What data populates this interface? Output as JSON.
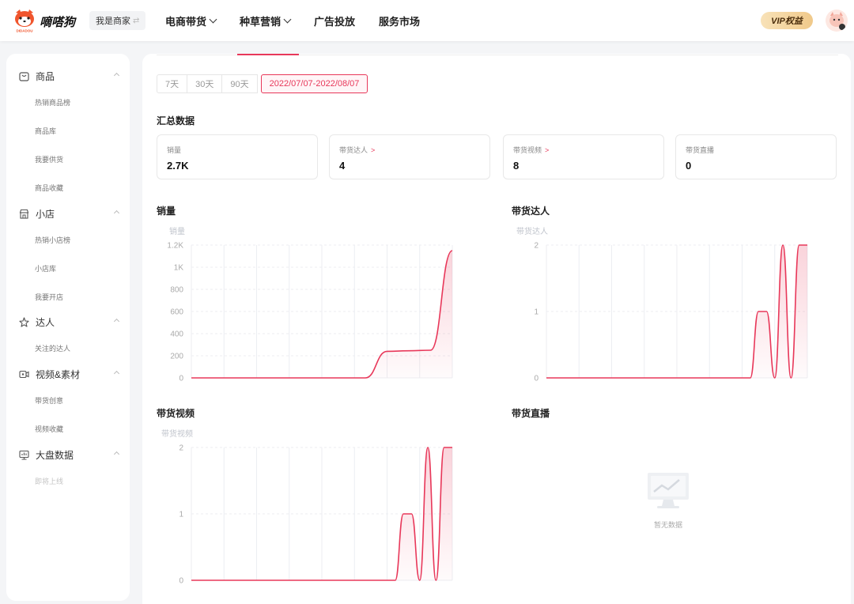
{
  "header": {
    "brand": "嘀嗒狗",
    "logo_text": "DIDADOU",
    "role_switch": "我是商家",
    "nav": [
      {
        "label": "电商带货",
        "has_dropdown": true
      },
      {
        "label": "种草营销",
        "has_dropdown": true
      },
      {
        "label": "广告投放",
        "has_dropdown": false
      },
      {
        "label": "服务市场",
        "has_dropdown": false
      }
    ],
    "vip_label": "VIP权益"
  },
  "sidebar": {
    "groups": [
      {
        "label": "商品",
        "icon": "product-icon",
        "items": [
          {
            "label": "热销商品榜"
          },
          {
            "label": "商品库"
          },
          {
            "label": "我要供货"
          },
          {
            "label": "商品收藏"
          }
        ]
      },
      {
        "label": "小店",
        "icon": "shop-icon",
        "items": [
          {
            "label": "热销小店榜"
          },
          {
            "label": "小店库"
          },
          {
            "label": "我要开店"
          }
        ]
      },
      {
        "label": "达人",
        "icon": "influencer-icon",
        "items": [
          {
            "label": "关注的达人"
          }
        ]
      },
      {
        "label": "视频&素材",
        "icon": "video-icon",
        "items": [
          {
            "label": "带货创意"
          },
          {
            "label": "视频收藏"
          }
        ]
      },
      {
        "label": "大盘数据",
        "icon": "dashboard-icon",
        "items": [
          {
            "label": "即将上线",
            "disabled": true
          }
        ]
      }
    ]
  },
  "main": {
    "ranges": [
      "7天",
      "30天",
      "90天"
    ],
    "active_range": "2022/07/07-2022/08/07",
    "summary_title": "汇总数据",
    "cards": [
      {
        "label": "销量",
        "value": "2.7K",
        "link": false
      },
      {
        "label": "带货达人",
        "value": "4",
        "link": true
      },
      {
        "label": "带货视频",
        "value": "8",
        "link": true
      },
      {
        "label": "带货直播",
        "value": "0",
        "link": false
      }
    ],
    "empty_text": "暂无数据",
    "accent": "#e8385a"
  },
  "chart_data": [
    {
      "type": "area",
      "title": "销量",
      "ylabel": "销量",
      "yticks": [
        "0",
        "200",
        "400",
        "600",
        "800",
        "1K",
        "1.2K"
      ],
      "ylim": [
        0,
        1200
      ],
      "x": [
        0,
        21,
        22,
        23,
        24,
        25,
        26,
        27,
        28,
        29,
        30,
        31
      ],
      "values": [
        0,
        0,
        0,
        0,
        0,
        0,
        0,
        0,
        0,
        240,
        245,
        250,
        1150
      ],
      "grid": true
    },
    {
      "type": "area",
      "title": "带货达人",
      "ylabel": "带货达人",
      "yticks": [
        "0",
        "1",
        "2"
      ],
      "ylim": [
        0,
        2
      ],
      "values": [
        0,
        0,
        0,
        0,
        0,
        0,
        0,
        0,
        0,
        0,
        0,
        0,
        0,
        0,
        0,
        0,
        0,
        0,
        0,
        0,
        0,
        0,
        0,
        0,
        0,
        0,
        1,
        1,
        0,
        2,
        0,
        2,
        2
      ],
      "grid": true
    },
    {
      "type": "area",
      "title": "带货视频",
      "ylabel": "带货视频",
      "yticks": [
        "0",
        "1",
        "2"
      ],
      "ylim": [
        0,
        2
      ],
      "values": [
        0,
        0,
        0,
        0,
        0,
        0,
        0,
        0,
        0,
        0,
        0,
        0,
        0,
        0,
        0,
        0,
        0,
        0,
        0,
        0,
        0,
        0,
        0,
        0,
        0,
        0,
        1,
        1,
        0,
        2,
        0,
        2,
        2
      ],
      "grid": true
    },
    {
      "type": "area",
      "title": "带货直播",
      "values": []
    }
  ]
}
